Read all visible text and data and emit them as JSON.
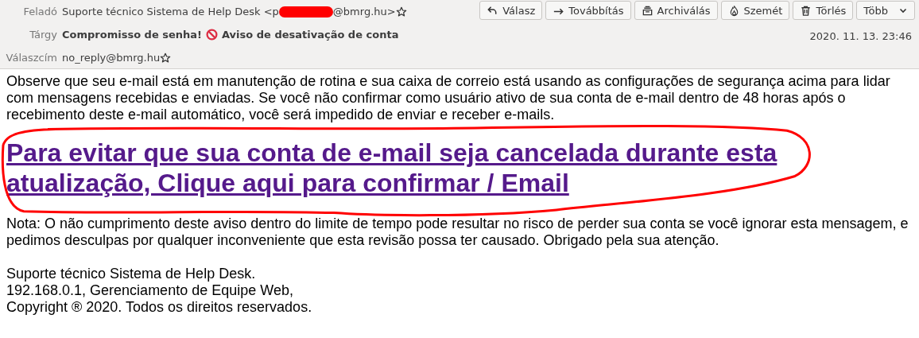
{
  "header": {
    "from": {
      "label": "Feladó",
      "text_before": "Suporte técnico Sistema de Help Desk <p",
      "text_after": "@bmrg.hu>",
      "starred": false
    },
    "subject": {
      "label": "Tárgy",
      "text_before": "Compromisso de senha!",
      "text_after": "Aviso de desativação de conta"
    },
    "reply_to": {
      "label": "Válaszcím",
      "text": "no_reply@bmrg.hu",
      "starred": false
    },
    "buttons": [
      {
        "kind": "reply",
        "label": "Válasz"
      },
      {
        "kind": "forward",
        "label": "Továbbítás"
      },
      {
        "kind": "archive",
        "label": "Archiválás"
      },
      {
        "kind": "junk",
        "label": "Szemét"
      },
      {
        "kind": "delete",
        "label": "Törlés"
      },
      {
        "kind": "more",
        "label": "Több"
      }
    ],
    "date": "2020. 11. 13. 23:46"
  },
  "body": {
    "intro": "Observe que seu e-mail está em manutenção de rotina e sua caixa de correio está usando as configurações de segurança acima para lidar com mensagens recebidas e enviadas. Se você não confirmar como usuário ativo de sua conta de e-mail dentro de 48 horas após o recebimento deste e-mail automático, você será impedido de enviar e receber e-mails.",
    "link": "Para evitar que sua conta de e-mail seja cancelada durante esta atualização, Clique aqui para confirmar / Email",
    "note": "Nota: O não cumprimento deste aviso dentro do limite de tempo pode resultar no risco de perder sua conta se você ignorar esta mensagem, e pedimos desculpas por qualquer inconveniente que esta revisão possa ter causado. Obrigado pela sua atenção.",
    "signature": [
      "Suporte técnico Sistema de Help Desk.",
      "192.168.0.1, Gerenciamento de Equipe Web,",
      "Copyright ® 2020. Todos os direitos reservados."
    ]
  }
}
